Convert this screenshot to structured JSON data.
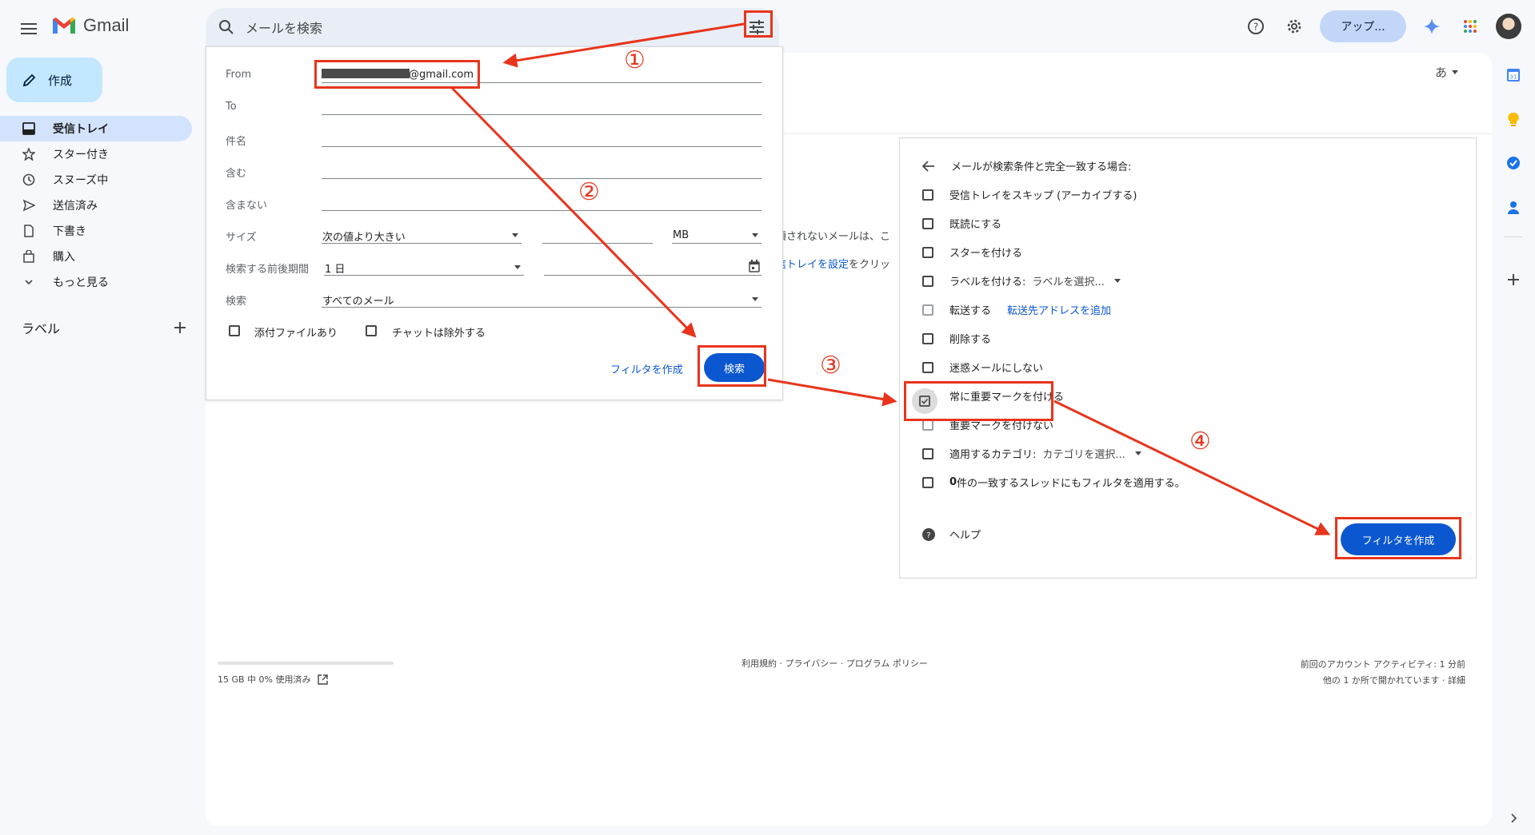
{
  "app": {
    "name": "Gmail"
  },
  "search": {
    "placeholder": "メールを検索"
  },
  "header": {
    "upgrade_label": "アップ..."
  },
  "sidebar": {
    "compose_label": "作成",
    "items": [
      {
        "label": "受信トレイ",
        "icon": "inbox-icon",
        "active": true
      },
      {
        "label": "スター付き",
        "icon": "star-icon"
      },
      {
        "label": "スヌーズ中",
        "icon": "clock-icon"
      },
      {
        "label": "送信済み",
        "icon": "send-icon"
      },
      {
        "label": "下書き",
        "icon": "draft-icon"
      },
      {
        "label": "購入",
        "icon": "shopping-bag-icon"
      },
      {
        "label": "もっと見る",
        "icon": "chevron-down-icon"
      }
    ],
    "labels_heading": "ラベル"
  },
  "main": {
    "input_tools_label": "あ",
    "bg_text_1": "頃されないメールは、こ",
    "bg_text_2_link": "信トレイを設定",
    "bg_text_2_rest": "をクリッ"
  },
  "search_options": {
    "from_label": "From",
    "from_value": "@gmail.com",
    "to_label": "To",
    "subject_label": "件名",
    "has_words_label": "含む",
    "doesnt_have_label": "含まない",
    "size_label": "サイズ",
    "size_operator": "次の値より大きい",
    "size_unit": "MB",
    "date_within_label": "検索する前後期間",
    "date_within_value": "1 日",
    "search_in_label": "検索",
    "search_in_value": "すべてのメール",
    "has_attachment_label": "添付ファイルあり",
    "exclude_chats_label": "チャットは除外する",
    "create_filter_link": "フィルタを作成",
    "search_button": "検索"
  },
  "filter_panel": {
    "heading": "メールが検索条件と完全一致する場合:",
    "options": {
      "skip_inbox": "受信トレイをスキップ (アーカイブする)",
      "mark_read": "既読にする",
      "star_it": "スターを付ける",
      "apply_label": "ラベルを付ける:",
      "apply_label_select": "ラベルを選択...",
      "forward": "転送する",
      "forward_link": "転送先アドレスを追加",
      "delete": "削除する",
      "never_spam": "迷惑メールにしない",
      "always_important": "常に重要マークを付ける",
      "never_important": "重要マークを付けない",
      "categorize": "適用するカテゴリ:",
      "categorize_select": "カテゴリを選択...",
      "also_apply_count": "0",
      "also_apply_rest": " 件の一致するスレッドにもフィルタを適用する。"
    },
    "help_label": "ヘルプ",
    "create_button": "フィルタを作成"
  },
  "footer": {
    "storage": "15 GB 中 0% 使用済み",
    "storage_used_fraction": 0.0,
    "links": "利用規約 · プライバシー · プログラム ポリシー",
    "activity_line1": "前回のアカウント アクティビティ: 1 分前",
    "activity_line2": "他の 1 か所で開かれています · 詳細"
  },
  "annotations": {
    "step1": "①",
    "step2": "②",
    "step3": "③",
    "step4": "④",
    "color": "#e8341c"
  },
  "colors": {
    "accent": "#0b57d0",
    "compose_bg": "#c2e7ff",
    "active_nav": "#d3e3fd"
  }
}
